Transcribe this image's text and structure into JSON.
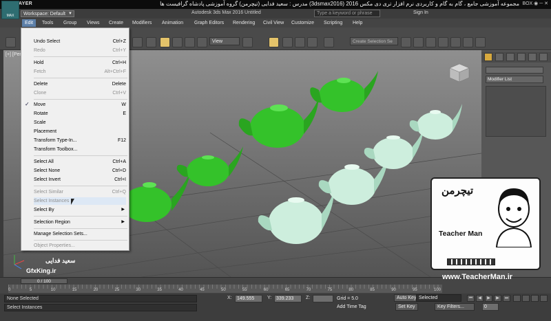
{
  "player": {
    "brand": "KMPLAYER",
    "title": "مجموعه آموزشی جامع ، گام به گام و کاربردی نرم افزار تری دی مکس 2016 (3dsmax2016) مدرس : سعید فدایی (تیچرمن) گروه آموزشی پادشاه گرافیست ها",
    "window_buttons": "BOX ◉ ─ ✕"
  },
  "app": {
    "icon_label": "MAX",
    "workspace": "Workspace: Default",
    "document_title": "Autodesk 3ds Max 2016      Untitled",
    "search_placeholder": "Type a keyword or phrase",
    "sign_in": "Sign In"
  },
  "menu": [
    "Edit",
    "Tools",
    "Group",
    "Views",
    "Create",
    "Modifiers",
    "Animation",
    "Graph Editors",
    "Rendering",
    "Civil View",
    "Customize",
    "Scripting",
    "Help"
  ],
  "toolbar": {
    "view_select": "View",
    "create_selection_set": "Create Selection Se"
  },
  "viewport": {
    "label": "[+] [Perspective] [Realistic]"
  },
  "edit_menu": {
    "items": [
      {
        "label": "Undo Select",
        "shortcut": "Ctrl+Z"
      },
      {
        "label": "Redo",
        "shortcut": "Ctrl+Y"
      },
      {
        "label": "Hold",
        "shortcut": "Ctrl+H"
      },
      {
        "label": "Fetch",
        "shortcut": "Alt+Ctrl+F"
      },
      {
        "label": "Delete",
        "shortcut": "Delete"
      },
      {
        "label": "Clone",
        "shortcut": "Ctrl+V"
      },
      {
        "label": "Move",
        "shortcut": "W"
      },
      {
        "label": "Rotate",
        "shortcut": "E"
      },
      {
        "label": "Scale",
        "shortcut": ""
      },
      {
        "label": "Placement",
        "shortcut": ""
      },
      {
        "label": "Transform Type-In...",
        "shortcut": "F12"
      },
      {
        "label": "Transform Toolbox...",
        "shortcut": ""
      },
      {
        "label": "Select All",
        "shortcut": "Ctrl+A"
      },
      {
        "label": "Select None",
        "shortcut": "Ctrl+D"
      },
      {
        "label": "Select Invert",
        "shortcut": "Ctrl+I"
      },
      {
        "label": "Select Similar",
        "shortcut": "Ctrl+Q"
      },
      {
        "label": "Select Instances",
        "shortcut": ""
      },
      {
        "label": "Select By",
        "shortcut": ""
      },
      {
        "label": "Selection Region",
        "shortcut": ""
      },
      {
        "label": "Manage Selection Sets...",
        "shortcut": ""
      },
      {
        "label": "Object Properties...",
        "shortcut": ""
      }
    ],
    "checked": "Move"
  },
  "command_panel": {
    "modifier_list": "Modifier List"
  },
  "watermark": {
    "logo_text": "تیچرمن",
    "name": "Teacher Man",
    "url": "www.TeacherMan.ir",
    "author": "سعید فدایی",
    "site": "GfxKing.ir"
  },
  "timeline": {
    "slider": "0 / 100",
    "ticks": [
      "0",
      "5",
      "10",
      "15",
      "20",
      "25",
      "30",
      "35",
      "40",
      "45",
      "50",
      "55",
      "60",
      "65",
      "70",
      "75",
      "80",
      "85",
      "90",
      "95",
      "100"
    ]
  },
  "status": {
    "selection": "None Selected",
    "prompt": "Select Instances",
    "x_label": "X:",
    "x_value": "149.555",
    "y_label": "Y:",
    "y_value": "339.233",
    "z_label": "Z:",
    "grid": "Grid = 5.0",
    "add_time_tag": "Add Time Tag",
    "auto_key": "Auto Key",
    "set_key": "Set Key",
    "selected": "Selected",
    "key_filters": "Key Filters...",
    "frame": "0"
  },
  "colors": {
    "teapot_green": "#34c22a",
    "teapot_pale": "#cdeedd",
    "menu_highlight": "#5c7fa8"
  }
}
